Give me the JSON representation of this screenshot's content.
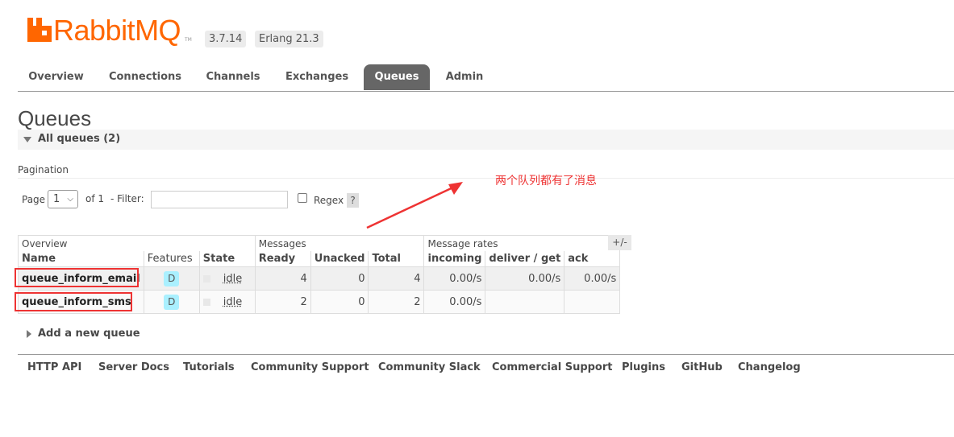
{
  "app": {
    "name": "RabbitMQ",
    "version": "3.7.14",
    "erlang": "Erlang 21.3"
  },
  "tabs": [
    {
      "label": "Overview"
    },
    {
      "label": "Connections"
    },
    {
      "label": "Channels"
    },
    {
      "label": "Exchanges"
    },
    {
      "label": "Queues",
      "active": true
    },
    {
      "label": "Admin"
    }
  ],
  "page_title": "Queues",
  "section_title": "All queues (2)",
  "pagination": {
    "label": "Pagination",
    "page_label": "Page",
    "page_value": "1",
    "of_label": "of 1",
    "filter_label": "- Filter:",
    "filter_value": "",
    "regex_label": "Regex",
    "help": "?"
  },
  "annotation": "两个队列都有了消息",
  "table": {
    "groups": {
      "overview": "Overview",
      "messages": "Messages",
      "rates": "Message rates",
      "toggle": "+/-"
    },
    "headers": [
      "Name",
      "Features",
      "State",
      "Ready",
      "Unacked",
      "Total",
      "incoming",
      "deliver / get",
      "ack"
    ],
    "rows": [
      {
        "name": "queue_inform_email",
        "feature": "D",
        "state": "idle",
        "ready": "4",
        "unacked": "0",
        "total": "4",
        "incoming": "0.00/s",
        "deliver": "0.00/s",
        "ack": "0.00/s"
      },
      {
        "name": "queue_inform_sms",
        "feature": "D",
        "state": "idle",
        "ready": "2",
        "unacked": "0",
        "total": "2",
        "incoming": "0.00/s",
        "deliver": "",
        "ack": ""
      }
    ]
  },
  "add_queue": "Add a new queue",
  "footer": [
    "HTTP API",
    "Server Docs",
    "Tutorials",
    "Community Support",
    "Community Slack",
    "Commercial Support",
    "Plugins",
    "GitHub",
    "Changelog"
  ],
  "colors": {
    "brand": "#ff6600",
    "tab_active_bg": "#666666",
    "annotation": "#ee3333"
  }
}
